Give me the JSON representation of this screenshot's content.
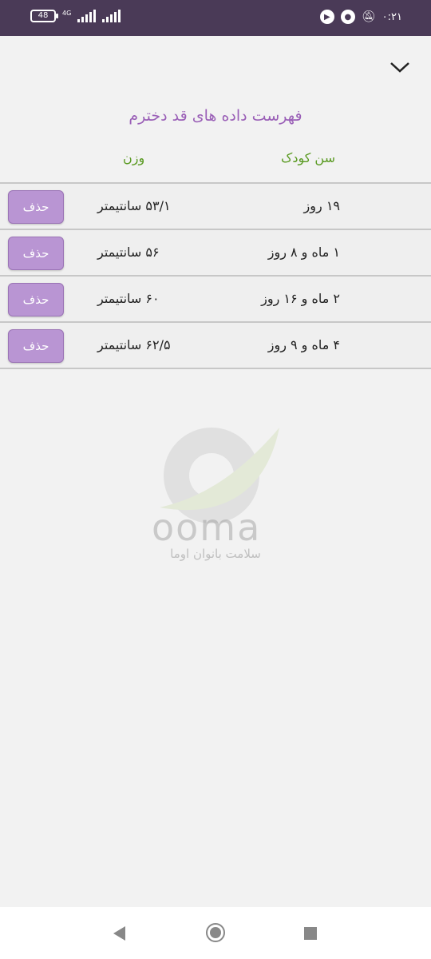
{
  "status_bar": {
    "battery": "48",
    "network": "4G",
    "time": "۰:۲۱"
  },
  "page": {
    "title": "فهرست داده های قد دخترم",
    "headers": {
      "age": "سن کودک",
      "weight": "وزن"
    }
  },
  "rows": [
    {
      "age": "۱۹ روز",
      "weight": "۵۳/۱ سانتیمتر",
      "delete_label": "حذف"
    },
    {
      "age": "۱ ماه و ۸ روز",
      "weight": "۵۶ سانتیمتر",
      "delete_label": "حذف"
    },
    {
      "age": "۲ ماه و ۱۶ روز",
      "weight": "۶۰ سانتیمتر",
      "delete_label": "حذف"
    },
    {
      "age": "۴ ماه و ۹ روز",
      "weight": "۶۲/۵ سانتیمتر",
      "delete_label": "حذف"
    }
  ],
  "watermark": {
    "brand": "ooma",
    "tagline": "سلامت بانوان اوما"
  },
  "colors": {
    "status_bar": "#4a3a57",
    "title": "#9a5fb7",
    "header": "#5a9a22",
    "button": "#b995d3"
  }
}
